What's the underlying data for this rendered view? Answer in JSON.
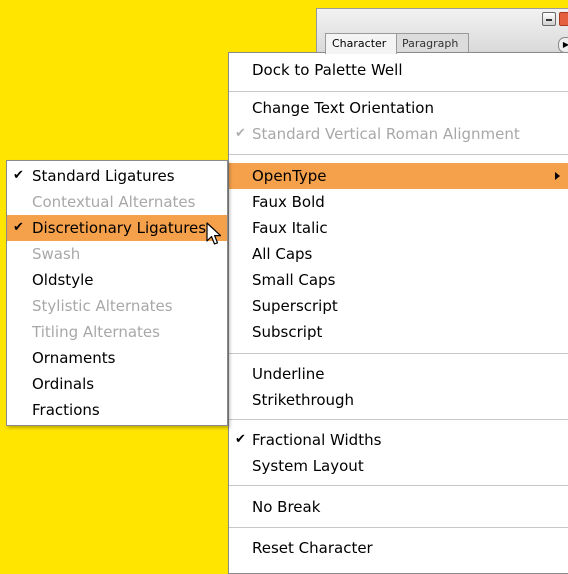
{
  "palette": {
    "tabs": [
      "Character",
      "Paragraph"
    ]
  },
  "main_menu": {
    "items": [
      {
        "label": "Dock to Palette Well"
      },
      {
        "label": "Change Text Orientation"
      },
      {
        "label": "Standard Vertical Roman Alignment",
        "checked": true,
        "disabled": true
      },
      {
        "label": "OpenType",
        "highlighted": true,
        "submenu": true
      },
      {
        "label": "Faux Bold"
      },
      {
        "label": "Faux Italic"
      },
      {
        "label": "All Caps"
      },
      {
        "label": "Small Caps"
      },
      {
        "label": "Superscript"
      },
      {
        "label": "Subscript"
      },
      {
        "label": "Underline"
      },
      {
        "label": "Strikethrough"
      },
      {
        "label": "Fractional Widths",
        "checked": true
      },
      {
        "label": "System Layout"
      },
      {
        "label": "No Break"
      },
      {
        "label": "Reset Character"
      }
    ]
  },
  "opentype_submenu": {
    "items": [
      {
        "label": "Standard Ligatures",
        "checked": true
      },
      {
        "label": "Contextual Alternates",
        "disabled": true
      },
      {
        "label": "Discretionary Ligatures",
        "checked": true,
        "highlighted": true
      },
      {
        "label": "Swash",
        "disabled": true
      },
      {
        "label": "Oldstyle"
      },
      {
        "label": "Stylistic Alternates",
        "disabled": true
      },
      {
        "label": "Titling Alternates",
        "disabled": true
      },
      {
        "label": "Ornaments"
      },
      {
        "label": "Ordinals"
      },
      {
        "label": "Fractions"
      }
    ]
  },
  "colors": {
    "background": "#FFE500",
    "highlight": "#F5A04B",
    "disabled_text": "#A8A8A8"
  }
}
